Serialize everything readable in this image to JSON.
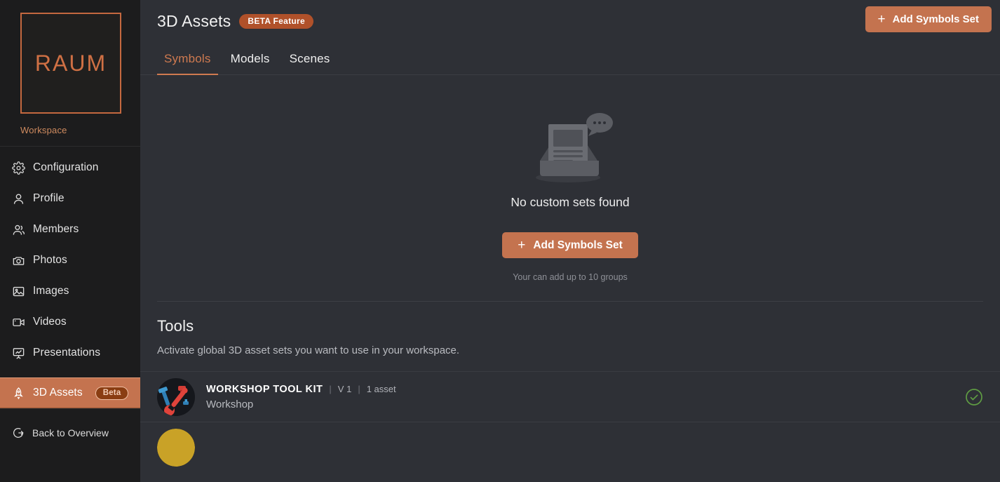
{
  "sidebar": {
    "logo_text": "RAUM",
    "workspace_label": "Workspace",
    "items": [
      {
        "label": "Configuration",
        "icon": "gear-icon"
      },
      {
        "label": "Profile",
        "icon": "user-icon"
      },
      {
        "label": "Members",
        "icon": "users-icon"
      },
      {
        "label": "Photos",
        "icon": "camera-icon"
      },
      {
        "label": "Images",
        "icon": "image-icon"
      },
      {
        "label": "Videos",
        "icon": "video-icon"
      },
      {
        "label": "Presentations",
        "icon": "presentation-icon"
      },
      {
        "label": "3D Assets",
        "icon": "rocket-icon",
        "badge": "Beta",
        "active": true
      }
    ],
    "back_label": "Back to Overview",
    "back_icon": "logout-icon",
    "active_color": "#c4734f",
    "accent_color": "#cf7044"
  },
  "header": {
    "title": "3D Assets",
    "badge": "BETA Feature",
    "add_button": "Add Symbols Set",
    "add_icon": "plus-icon"
  },
  "tabs": [
    {
      "label": "Symbols",
      "active": true
    },
    {
      "label": "Models",
      "active": false
    },
    {
      "label": "Scenes",
      "active": false
    }
  ],
  "empty_state": {
    "illustration": "empty-inbox-illustration",
    "title": "No custom sets found",
    "button": "Add Symbols Set",
    "button_icon": "plus-icon",
    "hint": "Your can add up to 10 groups"
  },
  "tools": {
    "title": "Tools",
    "subtitle": "Activate global 3D asset sets you want to use in your workspace.",
    "rows": [
      {
        "name": "WORKSHOP TOOL KIT",
        "version": "V 1",
        "assets": "1 asset",
        "category": "Workshop",
        "thumbnail": "workshop-tools-thumbnail",
        "status_icon": "check-circle-icon",
        "status_color": "#5f9c43"
      }
    ]
  }
}
